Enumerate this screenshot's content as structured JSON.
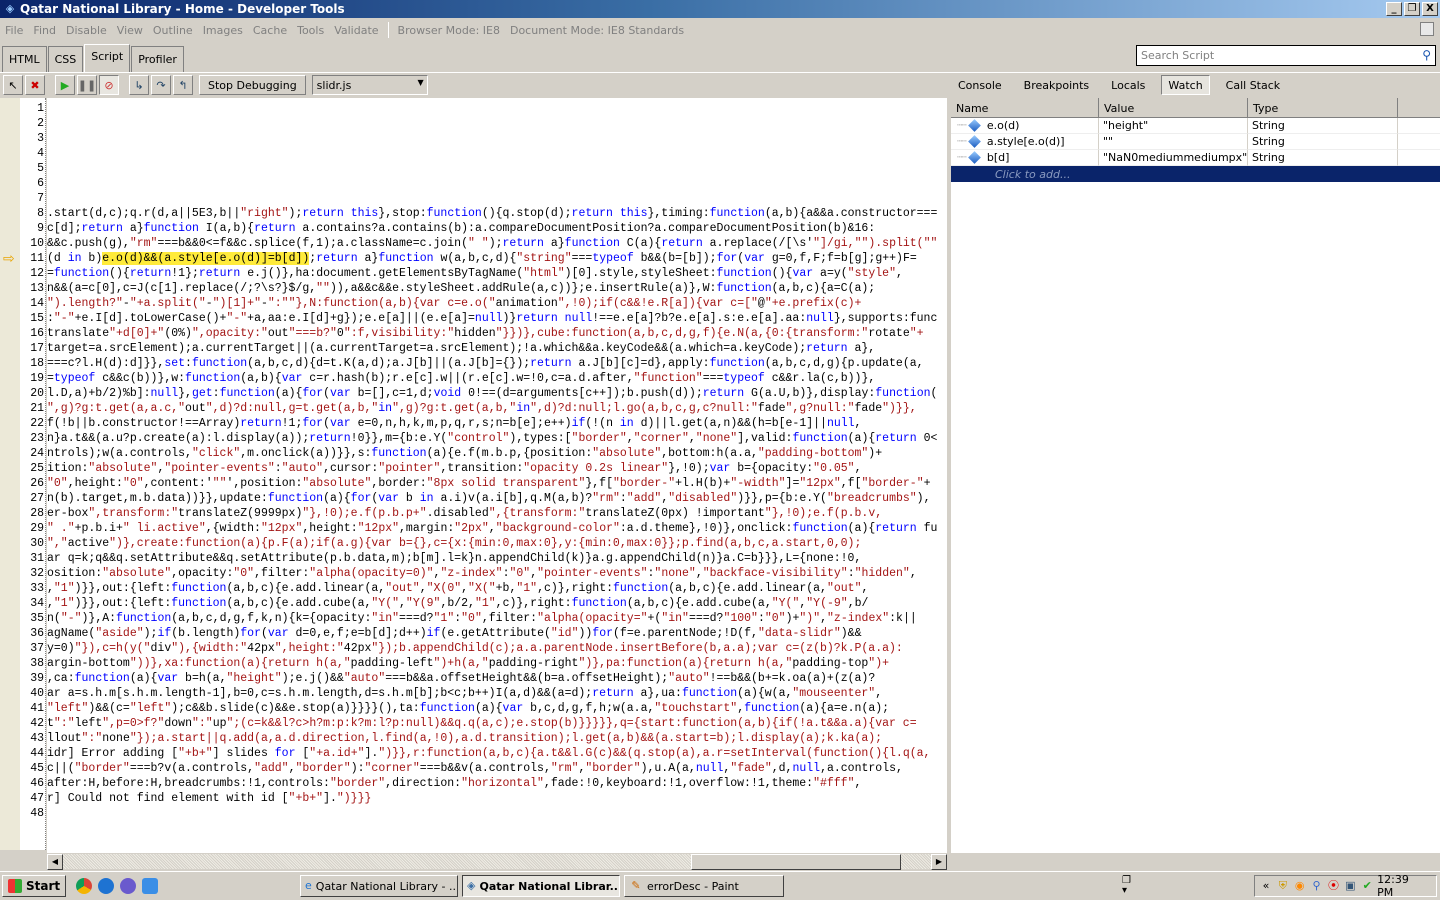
{
  "window": {
    "title": "Qatar National Library - Home - Developer Tools",
    "controls": {
      "minimize": "_",
      "restore": "❐",
      "close": "X"
    }
  },
  "menu": {
    "items": [
      "File",
      "Find",
      "Disable",
      "View",
      "Outline",
      "Images",
      "Cache",
      "Tools",
      "Validate"
    ],
    "browser_mode": "Browser Mode: IE8",
    "document_mode": "Document Mode: IE8 Standards"
  },
  "tabs": [
    {
      "label": "HTML",
      "active": false
    },
    {
      "label": "CSS",
      "active": false
    },
    {
      "label": "Script",
      "active": true
    },
    {
      "label": "Profiler",
      "active": false
    }
  ],
  "search": {
    "placeholder": "Search Script",
    "icon": "search-icon"
  },
  "toolbar": {
    "icons": [
      "select-element-icon",
      "clear-browser-icon",
      "continue-icon",
      "break-icon",
      "break-on-error-icon",
      "step-into-icon",
      "step-over-icon",
      "step-out-icon"
    ],
    "stop_debugging_label": "Stop Debugging",
    "file_select_value": "slidr.js"
  },
  "right_tabs": [
    {
      "label": "Console",
      "active": false
    },
    {
      "label": "Breakpoints",
      "active": false
    },
    {
      "label": "Locals",
      "active": false
    },
    {
      "label": "Watch",
      "active": true
    },
    {
      "label": "Call Stack",
      "active": false
    }
  ],
  "watch": {
    "columns": [
      "Name",
      "Value",
      "Type"
    ],
    "rows": [
      {
        "name": "e.o(d)",
        "value": "\"height\"",
        "type": "String"
      },
      {
        "name": "a.style[e.o(d)]",
        "value": "\"\"",
        "type": "String"
      },
      {
        "name": "b[d]",
        "value": "\"NaN0mediummediumpx\"",
        "type": "String"
      }
    ],
    "add_placeholder": "Click to add..."
  },
  "code": {
    "current_line": 11,
    "highlight": "e.o(d)&&(a.style[e.o(d)]=b[d])",
    "lines": [
      "",
      "",
      "",
      "",
      "",
      "",
      "",
      ".start(d,c);q.r(d,a||5E3,b||\"right\");return this},stop:function(){q.stop(d);return this},timing:function(a,b){a&&a.constructor===",
      "c[d];return a}function I(a,b){return a.contains?a.contains(b):a.compareDocumentPosition?a.compareDocumentPosition(b)&16:",
      "&&c.push(g),\"rm\"===b&&0<=f&&c.splice(f,1);a.className=c.join(\" \");return a}function C(a){return a.replace(/[\\s'\"]/gi,\"\").split(\"\"",
      "(d in b)e.o(d)&&(a.style[e.o(d)]=b[d]);return a}function w(a,b,c,d){\"string\"===typeof b&&(b=[b]);for(var g=0,f,F;f=b[g];g++)F=",
      "=function(){return!1};return e.j()},ha:document.getElementsByTagName(\"html\")[0].style,styleSheet:function(){var a=y(\"style\",",
      "n&&(a=c[0],c=J(c[1].replace(/;?\\s?}$/g,\"\")),a&&c&&e.styleSheet.addRule(a,c))};e.insertRule(a)},W:function(a,b,c){a=C(a);",
      "\").length?\"-\"+a.split(\"-\")[1]+\"-\":\"\"},N:function(a,b){var c=e.o(\"animation\",!0);if(c&&!e.R[a]){var c=[\"@\"+e.prefix(c)+",
      ":\"-\"+e.I[d].toLowerCase()+\"-\"+a,aa:e.I[d]+g});e.e[a]||(e.e[a]=null)}return null!==e.e[a]?b?e.e[a].s:e.e[a].aa:null},supports:func",
      "translate\"+d[0]+\"(0%)\",opacity:\"out\"===b?\"0\":f,visibility:\"hidden\"}})},cube:function(a,b,c,d,g,f){e.N(a,{0:{transform:\"rotate\"+",
      "target=a.srcElement);a.currentTarget||(a.currentTarget=a.srcElement);!a.which&&a.keyCode&&(a.which=a.keyCode);return a},",
      "===c?l.H(d):d]}},set:function(a,b,c,d){d=t.K(a,d);a.J[b]||(a.J[b]={});return a.J[b][c]=d},apply:function(a,b,c,d,g){p.update(a,",
      "=typeof c&&c(b))},w:function(a,b){var c=r.hash(b);r.e[c].w||(r.e[c].w=!0,c=a.d.after,\"function\"===typeof c&&r.la(c,b))},",
      "l.D,a)+b/2)%b]:null},get:function(a){for(var b=[],c=1,d;void 0!==(d=arguments[c++]);b.push(d));return G(a.U,b)},display:function(",
      "\",g)?g:t.get(a,a.c,\"out\",d)?d:null,g=t.get(a,b,\"in\",g)?g:t.get(a,b,\"in\",d)?d:null;l.go(a,b,c,g,c?null:\"fade\",g?null:\"fade\")}},",
      "f(!b||b.constructor!==Array)return!1;for(var e=0,n,h,k,m,p,q,r,s;n=b[e];e++)if(!(n in d)||l.get(a,n)&&(h=b[e-1]||null,",
      "n}a.t&&(a.u?p.create(a):l.display(a));return!0}},m={b:e.Y(\"control\"),types:[\"border\",\"corner\",\"none\"],valid:function(a){return 0<",
      "ntrols);w(a.controls,\"click\",m.onclick(a))}},s:function(a){e.f(m.b.p,{position:\"absolute\",bottom:h(a.a,\"padding-bottom\")+",
      "ition:\"absolute\",\"pointer-events\":\"auto\",cursor:\"pointer\",transition:\"opacity 0.2s linear\"},!0);var b={opacity:\"0.05\",",
      "\"0\",height:\"0\",content:'\"\"',position:\"absolute\",border:\"8px solid transparent\"},f[\"border-\"+l.H(b)+\"-width\"]=\"12px\",f[\"border-\"+",
      "n(b).target,m.b.data))}},update:function(a){for(var b in a.i)v(a.i[b],q.M(a,b)?\"rm\":\"add\",\"disabled\")}},p={b:e.Y(\"breadcrumbs\"),",
      "er-box\",transform:\"translateZ(9999px)\"},!0);e.f(p.b.p+\".disabled\",{transform:\"translateZ(0px) !important\"},!0);e.f(p.b.v,",
      "\" .\"+p.b.i+\" li.active\",{width:\"12px\",height:\"12px\",margin:\"2px\",\"background-color\":a.d.theme},!0)},onclick:function(a){return fu",
      "\",\"active\")},create:function(a){p.F(a);if(a.g){var b={},c={x:{min:0,max:0},y:{min:0,max:0}};p.find(a,b,c,a.start,0,0);",
      "ar q=k;q&&q.setAttribute&&q.setAttribute(p.b.data,m);b[m].l=k}n.appendChild(k)}a.g.appendChild(n)}a.C=b}}},L={none:!0,",
      "osition:\"absolute\",opacity:\"0\",filter:\"alpha(opacity=0)\",\"z-index\":\"0\",\"pointer-events\":\"none\",\"backface-visibility\":\"hidden\",",
      ",\"1\")}},out:{left:function(a,b,c){e.add.linear(a,\"out\",\"X(0\",\"X(\"+b,\"1\",c)},right:function(a,b,c){e.add.linear(a,\"out\",",
      ",\"1\")}},out:{left:function(a,b,c){e.add.cube(a,\"Y(\",\"Y(9\",b/2,\"1\",c)},right:function(a,b,c){e.add.cube(a,\"Y(\",\"Y(-9\",b/",
      "n(\"-\")},A:function(a,b,c,d,g,f,k,n){k={opacity:\"in\"===d?\"1\":\"0\",filter:\"alpha(opacity=\"+(\"in\"===d?\"100\":\"0\")+\")\",\"z-index\":k||",
      "agName(\"aside\");if(b.length)for(var d=0,e,f;e=b[d];d++)if(e.getAttribute(\"id\"))for(f=e.parentNode;!D(f,\"data-slidr\")&&",
      "y=0)\"}),c=h(y(\"div\"),{width:\"42px\",height:\"42px\"});b.appendChild(c);a.a.parentNode.insertBefore(b,a.a);var c=(z(b)?k.P(a.a):",
      "argin-bottom\"))},xa:function(a){return h(a,\"padding-left\")+h(a,\"padding-right\")},pa:function(a){return h(a,\"padding-top\")+",
      ",ca:function(a){var b=h(a,\"height\");e.j()&&\"auto\"===b&&a.offsetHeight&&(b=a.offsetHeight);\"auto\"!==b&&(b+=k.oa(a)+(z(a)?",
      "ar a=s.h.m[s.h.m.length-1],b=0,c=s.h.m.length,d=s.h.m[b];b<c;b++)I(a,d)&&(a=d);return a},ua:function(a){w(a,\"mouseenter\",",
      "\"left\")&&(c=\"left\");c&&b.slide(c)&&e.stop(a)}}}}(),ta:function(a){var b,c,d,g,f,h;w(a.a,\"touchstart\",function(a){a=e.n(a);",
      "t\":\"left\",p=0>f?\"down\":\"up\";(c=k&&l?c>h?m:p:k?m:l?p:null)&&q.q(a,c);e.stop(b)}}}}},q={start:function(a,b){if(!a.t&&a.a){var c=",
      "llout\":\"none\"});a.start||q.add(a,a.d.direction,l.find(a,!0),a.d.transition);l.get(a,b)&&(a.start=b);l.display(a);k.ka(a);",
      "idr] Error adding [\"+b+\"] slides for [\"+a.id+\"].\")}},r:function(a,b,c){a.t&&l.G(c)&&(q.stop(a),a.r=setInterval(function(){l.q(a,",
      "c||(\"border\"===b?v(a.controls,\"add\",\"border\"):\"corner\"===b&&v(a.controls,\"rm\",\"border\"),u.A(a,null,\"fade\",d,null,a.controls,",
      "after:H,before:H,breadcrumbs:!1,controls:\"border\",direction:\"horizontal\",fade:!0,keyboard:!1,overflow:!1,theme:\"#fff\",",
      "r] Could not find element with id [\"+b+\"].\")}}}",
      ""
    ]
  },
  "taskbar": {
    "start_label": "Start",
    "quick_launch": [
      "chrome-icon",
      "ie-icon",
      "media-icon",
      "ie-alt-icon"
    ],
    "tasks": [
      {
        "label": "Qatar National Library - ...",
        "icon": "ie-icon",
        "active": false
      },
      {
        "label": "Qatar National Librar...",
        "icon": "devtools-icon",
        "active": true
      },
      {
        "label": "errorDesc - Paint",
        "icon": "paint-icon",
        "active": false
      }
    ],
    "tray_icons": [
      "security-icon",
      "avast-icon",
      "search-icon",
      "record-icon",
      "network-icon",
      "usb-icon"
    ],
    "clock": "12:39 PM"
  },
  "colors": {
    "keyword": "#0000ff",
    "string": "#a31515",
    "highlight": "#ffeb3b",
    "selection": "#0a246a"
  }
}
